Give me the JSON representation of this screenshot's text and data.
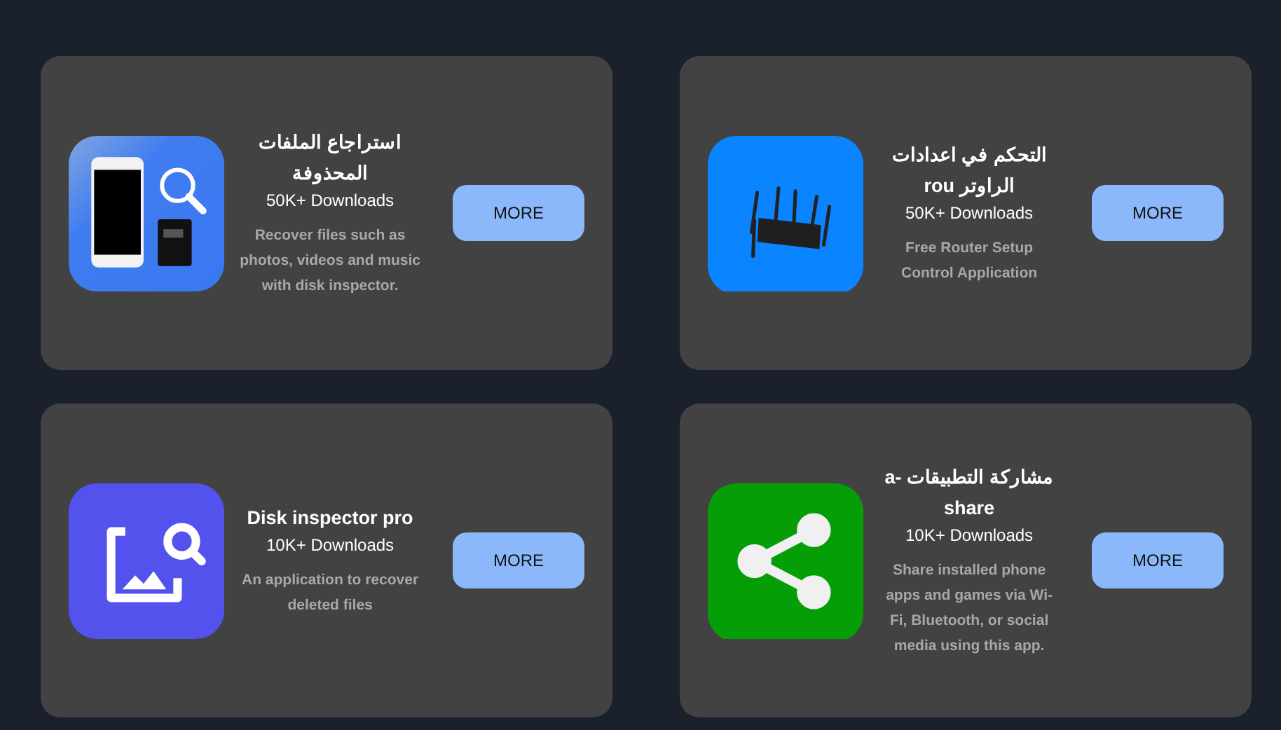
{
  "apps": [
    {
      "title": "استراجاع الملفات المحذوفة",
      "downloads": "50K+ Downloads",
      "description": "Recover files such as photos, videos and music with disk inspector.",
      "button": "MORE"
    },
    {
      "title": "التحكم في اعدادات الراوتر rou",
      "downloads": "50K+ Downloads",
      "description": "Free Router Setup Control Application",
      "button": "MORE"
    },
    {
      "title": "Disk inspector pro",
      "downloads": "10K+ Downloads",
      "description": "An application to recover deleted files",
      "button": "MORE"
    },
    {
      "title": "مشاركة التطبيقات a-share",
      "downloads": "10K+ Downloads",
      "description": "Share installed phone apps and games via Wi-Fi, Bluetooth, or social media using this app.",
      "button": "MORE"
    }
  ]
}
